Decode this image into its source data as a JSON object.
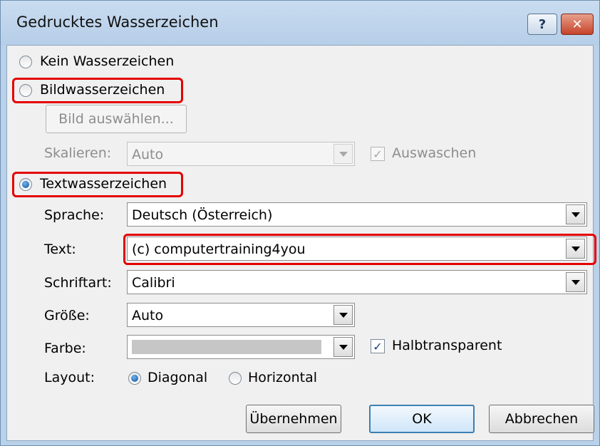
{
  "window": {
    "title": "Gedrucktes Wasserzeichen"
  },
  "titlebar": {
    "help_label": "?",
    "close_label": "✕"
  },
  "options": {
    "none": {
      "label": "Kein Wasserzeichen",
      "selected": false
    },
    "picture": {
      "label": "Bildwasserzeichen",
      "selected": false
    },
    "text": {
      "label": "Textwasserzeichen",
      "selected": true
    }
  },
  "picture_section": {
    "select_button": "Bild auswählen...",
    "scale_label": "Skalieren:",
    "scale_value": "Auto",
    "washout_label": "Auswaschen",
    "washout_checked": true
  },
  "text_section": {
    "language_label": "Sprache:",
    "language_value": "Deutsch (Österreich)",
    "text_label": "Text:",
    "text_value": "(c) computertraining4you",
    "font_label": "Schriftart:",
    "font_value": "Calibri",
    "size_label": "Größe:",
    "size_value": "Auto",
    "color_label": "Farbe:",
    "color_value": "#c6c6c6",
    "semitransparent_label": "Halbtransparent",
    "semitransparent_checked": true,
    "layout_label": "Layout:",
    "layout_diagonal": "Diagonal",
    "layout_horizontal": "Horizontal",
    "layout_selected": "Diagonal"
  },
  "buttons": {
    "apply": "Übernehmen",
    "ok": "OK",
    "cancel": "Abbrechen"
  }
}
